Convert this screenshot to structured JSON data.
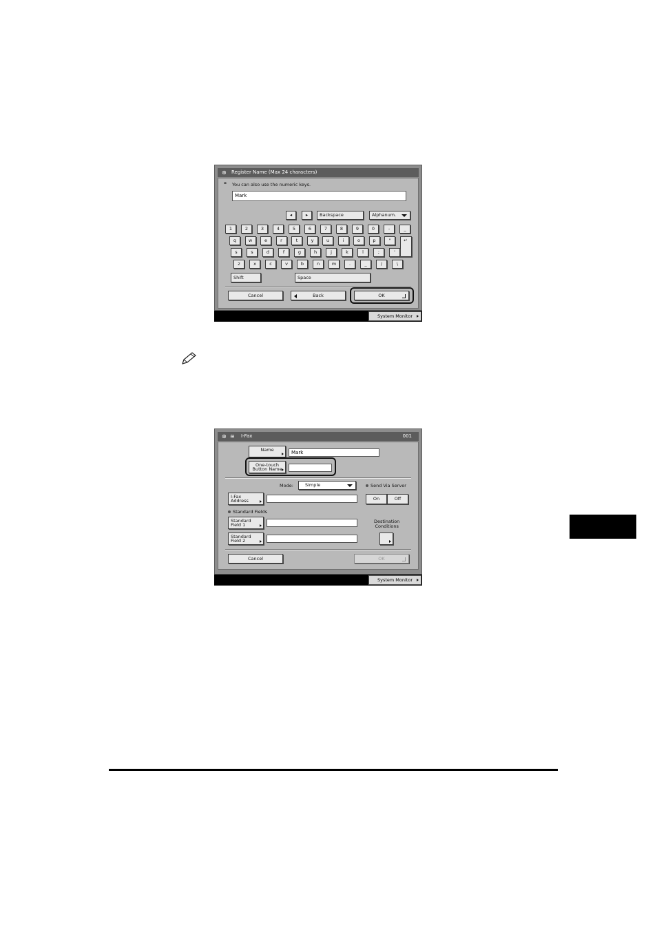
{
  "screen1": {
    "title": "Register Name (Max 24 characters)",
    "hint": "You can also use the numeric keys.",
    "input_value": "Mark",
    "nav_left": "◂",
    "nav_right": "▸",
    "backspace": "Backspace",
    "mode_select": "Alphanum.",
    "row1": [
      "1",
      "2",
      "3",
      "4",
      "5",
      "6",
      "7",
      "8",
      "9",
      "0",
      "-",
      "_"
    ],
    "row2": [
      "q",
      "w",
      "e",
      "r",
      "t",
      "y",
      "u",
      "i",
      "o",
      "p",
      "\"",
      "↵"
    ],
    "row3": [
      "s",
      "s",
      "d",
      "f",
      "g",
      "h",
      "j",
      "k",
      "l",
      ";",
      "'"
    ],
    "row4": [
      "z",
      "x",
      "c",
      "v",
      "b",
      "n",
      "m",
      ".",
      "_",
      "/",
      "\\"
    ],
    "shift": "Shift",
    "space": "Space",
    "cancel": "Cancel",
    "back": "Back",
    "ok": "OK",
    "system_monitor": "System Monitor"
  },
  "screen2": {
    "title": "I-Fax",
    "number": "001",
    "name_button": "Name",
    "name_value": "Mark",
    "onetouch_line1": "One-touch",
    "onetouch_line2": "Button Name",
    "onetouch_value": "",
    "mode_label": "Mode:",
    "mode_value": "Simple",
    "send_via_server": "Send Via Server",
    "on": "On",
    "off": "Off",
    "ifax_line1": "I-Fax",
    "ifax_line2": "Address",
    "standard_fields": "Standard Fields",
    "sf1_line1": "Standard",
    "sf1_line2": "Field 1",
    "sf2_line1": "Standard",
    "sf2_line2": "Field 2",
    "dest_line1": "Destination",
    "dest_line2": "Conditions",
    "cancel": "Cancel",
    "ok": "OK",
    "system_monitor": "System Monitor"
  },
  "icons": [
    "pencil-icon",
    "keyboard-icon",
    "home-icon",
    "fax-icon"
  ]
}
